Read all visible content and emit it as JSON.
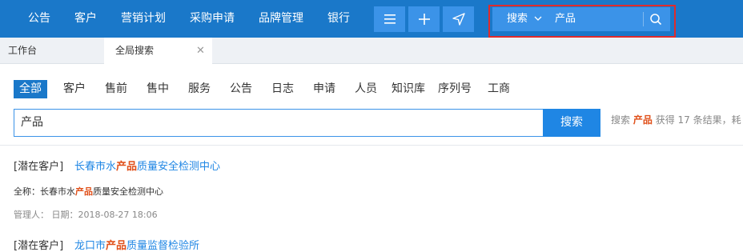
{
  "nav": {
    "items": [
      "公告",
      "客户",
      "营销计划",
      "采购申请",
      "品牌管理",
      "银行"
    ]
  },
  "toolbar": {
    "icons": [
      "menu-icon",
      "plus-icon",
      "send-icon"
    ]
  },
  "header_search": {
    "scope": "搜索",
    "value": "产品",
    "icon": "search-icon"
  },
  "tabs": [
    {
      "label": "工作台"
    },
    {
      "label": "全局搜索"
    }
  ],
  "categories": [
    "全部",
    "客户",
    "售前",
    "售中",
    "服务",
    "公告",
    "日志",
    "申请",
    "人员",
    "知识库",
    "序列号",
    "工商"
  ],
  "search": {
    "value": "产品",
    "button": "搜索"
  },
  "result_info": {
    "prefix": "搜索",
    "keyword": "产品",
    "suffix": "获得 17 条结果，耗"
  },
  "results": [
    {
      "type": "[潜在客户]",
      "title_pre": "长春市水",
      "title_kw": "产品",
      "title_post": "质量安全检测中心",
      "full_pre": "全称：长春市水",
      "full_kw": "产品",
      "full_post": "质量安全检测中心",
      "meta": "管理人：   日期：2018-08-27 18:06"
    },
    {
      "type": "[潜在客户]",
      "title_pre": "龙口市",
      "title_kw": "产品",
      "title_post": "质量监督检验所"
    }
  ],
  "colors": {
    "primary": "#1a78c9",
    "button": "#3b93e8",
    "highlight": "#e0501a",
    "link": "#1f86e4",
    "annotation": "#e02b2b"
  }
}
